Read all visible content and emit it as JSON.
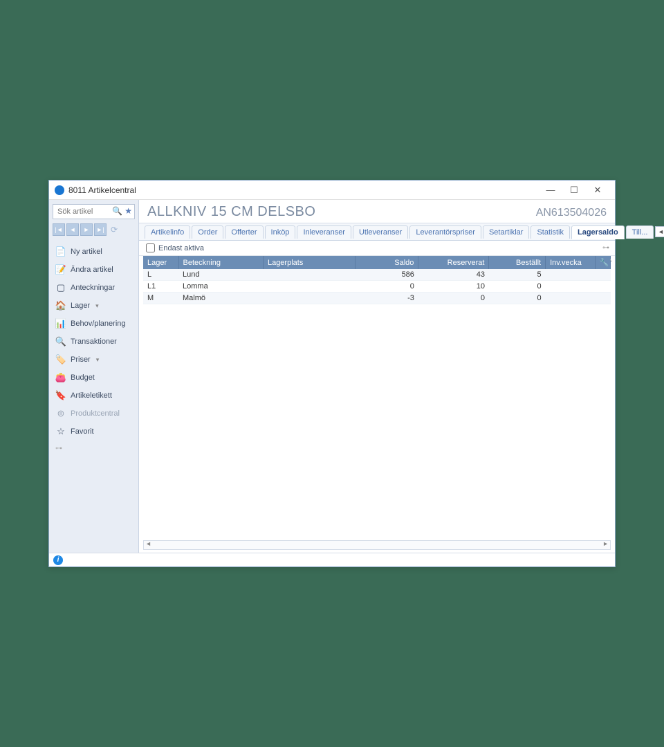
{
  "window": {
    "title": "8011 Artikelcentral"
  },
  "search": {
    "placeholder": "Sök artikel"
  },
  "sidebar": {
    "items": [
      {
        "label": "Ny artikel",
        "icon": "📄"
      },
      {
        "label": "Ändra artikel",
        "icon": "📝"
      },
      {
        "label": "Anteckningar",
        "icon": "▢"
      },
      {
        "label": "Lager",
        "icon": "🏠",
        "dropdown": true
      },
      {
        "label": "Behov/planering",
        "icon": "📊"
      },
      {
        "label": "Transaktioner",
        "icon": "🔍"
      },
      {
        "label": "Priser",
        "icon": "🏷️",
        "dropdown": true
      },
      {
        "label": "Budget",
        "icon": "👛"
      },
      {
        "label": "Artikeletikett",
        "icon": "🔖"
      },
      {
        "label": "Produktcentral",
        "icon": "⊜",
        "muted": true
      },
      {
        "label": "Favorit",
        "icon": "☆"
      }
    ]
  },
  "header": {
    "title": "ALLKNIV 15 CM DELSBO",
    "code": "AN613504026"
  },
  "tabs": [
    {
      "label": "Artikelinfo"
    },
    {
      "label": "Order"
    },
    {
      "label": "Offerter"
    },
    {
      "label": "Inköp"
    },
    {
      "label": "Inleveranser"
    },
    {
      "label": "Utleveranser"
    },
    {
      "label": "Leverantörspriser"
    },
    {
      "label": "Setartiklar"
    },
    {
      "label": "Statistik"
    },
    {
      "label": "Lagersaldo",
      "active": true
    },
    {
      "label": "Till..."
    }
  ],
  "filter": {
    "only_active_label": "Endast aktiva"
  },
  "table": {
    "columns": [
      {
        "label": "Lager"
      },
      {
        "label": "Beteckning"
      },
      {
        "label": "Lagerplats"
      },
      {
        "label": "Saldo",
        "num": true
      },
      {
        "label": "Reserverat",
        "num": true
      },
      {
        "label": "Beställt",
        "num": true
      },
      {
        "label": "Inv.vecka"
      }
    ],
    "rows": [
      {
        "lager": "L",
        "beteckning": "Lund",
        "lagerplats": "",
        "saldo": "586",
        "reserverat": "43",
        "bestallt": "5",
        "invvecka": ""
      },
      {
        "lager": "L1",
        "beteckning": "Lomma",
        "lagerplats": "",
        "saldo": "0",
        "reserverat": "10",
        "bestallt": "0",
        "invvecka": ""
      },
      {
        "lager": "M",
        "beteckning": "Malmö",
        "lagerplats": "",
        "saldo": "-3",
        "reserverat": "0",
        "bestallt": "0",
        "invvecka": ""
      }
    ]
  }
}
